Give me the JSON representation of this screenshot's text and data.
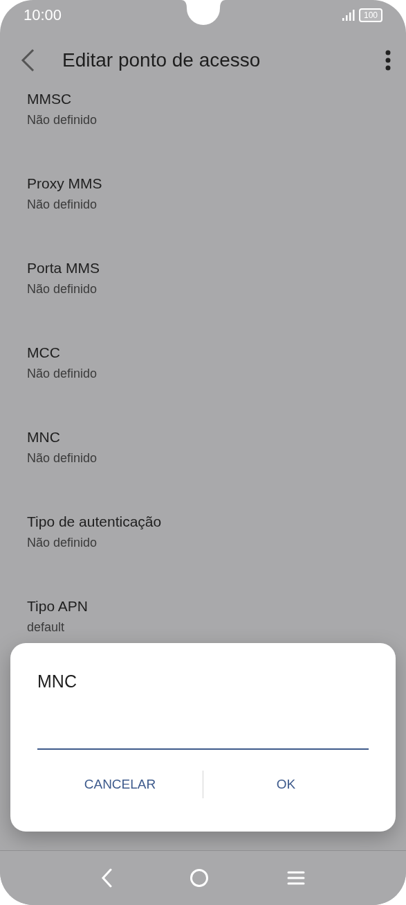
{
  "status_bar": {
    "time": "10:00",
    "battery": "100"
  },
  "header": {
    "title": "Editar ponto de acesso"
  },
  "settings": [
    {
      "label": "MMSC",
      "value": "Não definido"
    },
    {
      "label": "Proxy MMS",
      "value": "Não definido"
    },
    {
      "label": "Porta MMS",
      "value": "Não definido"
    },
    {
      "label": "MCC",
      "value": "Não definido"
    },
    {
      "label": "MNC",
      "value": "Não definido"
    },
    {
      "label": "Tipo de autenticação",
      "value": "Não definido"
    },
    {
      "label": "Tipo APN",
      "value": "default"
    }
  ],
  "dialog": {
    "title": "MNC",
    "buttons": [
      "CANCELAR",
      "OK"
    ]
  }
}
